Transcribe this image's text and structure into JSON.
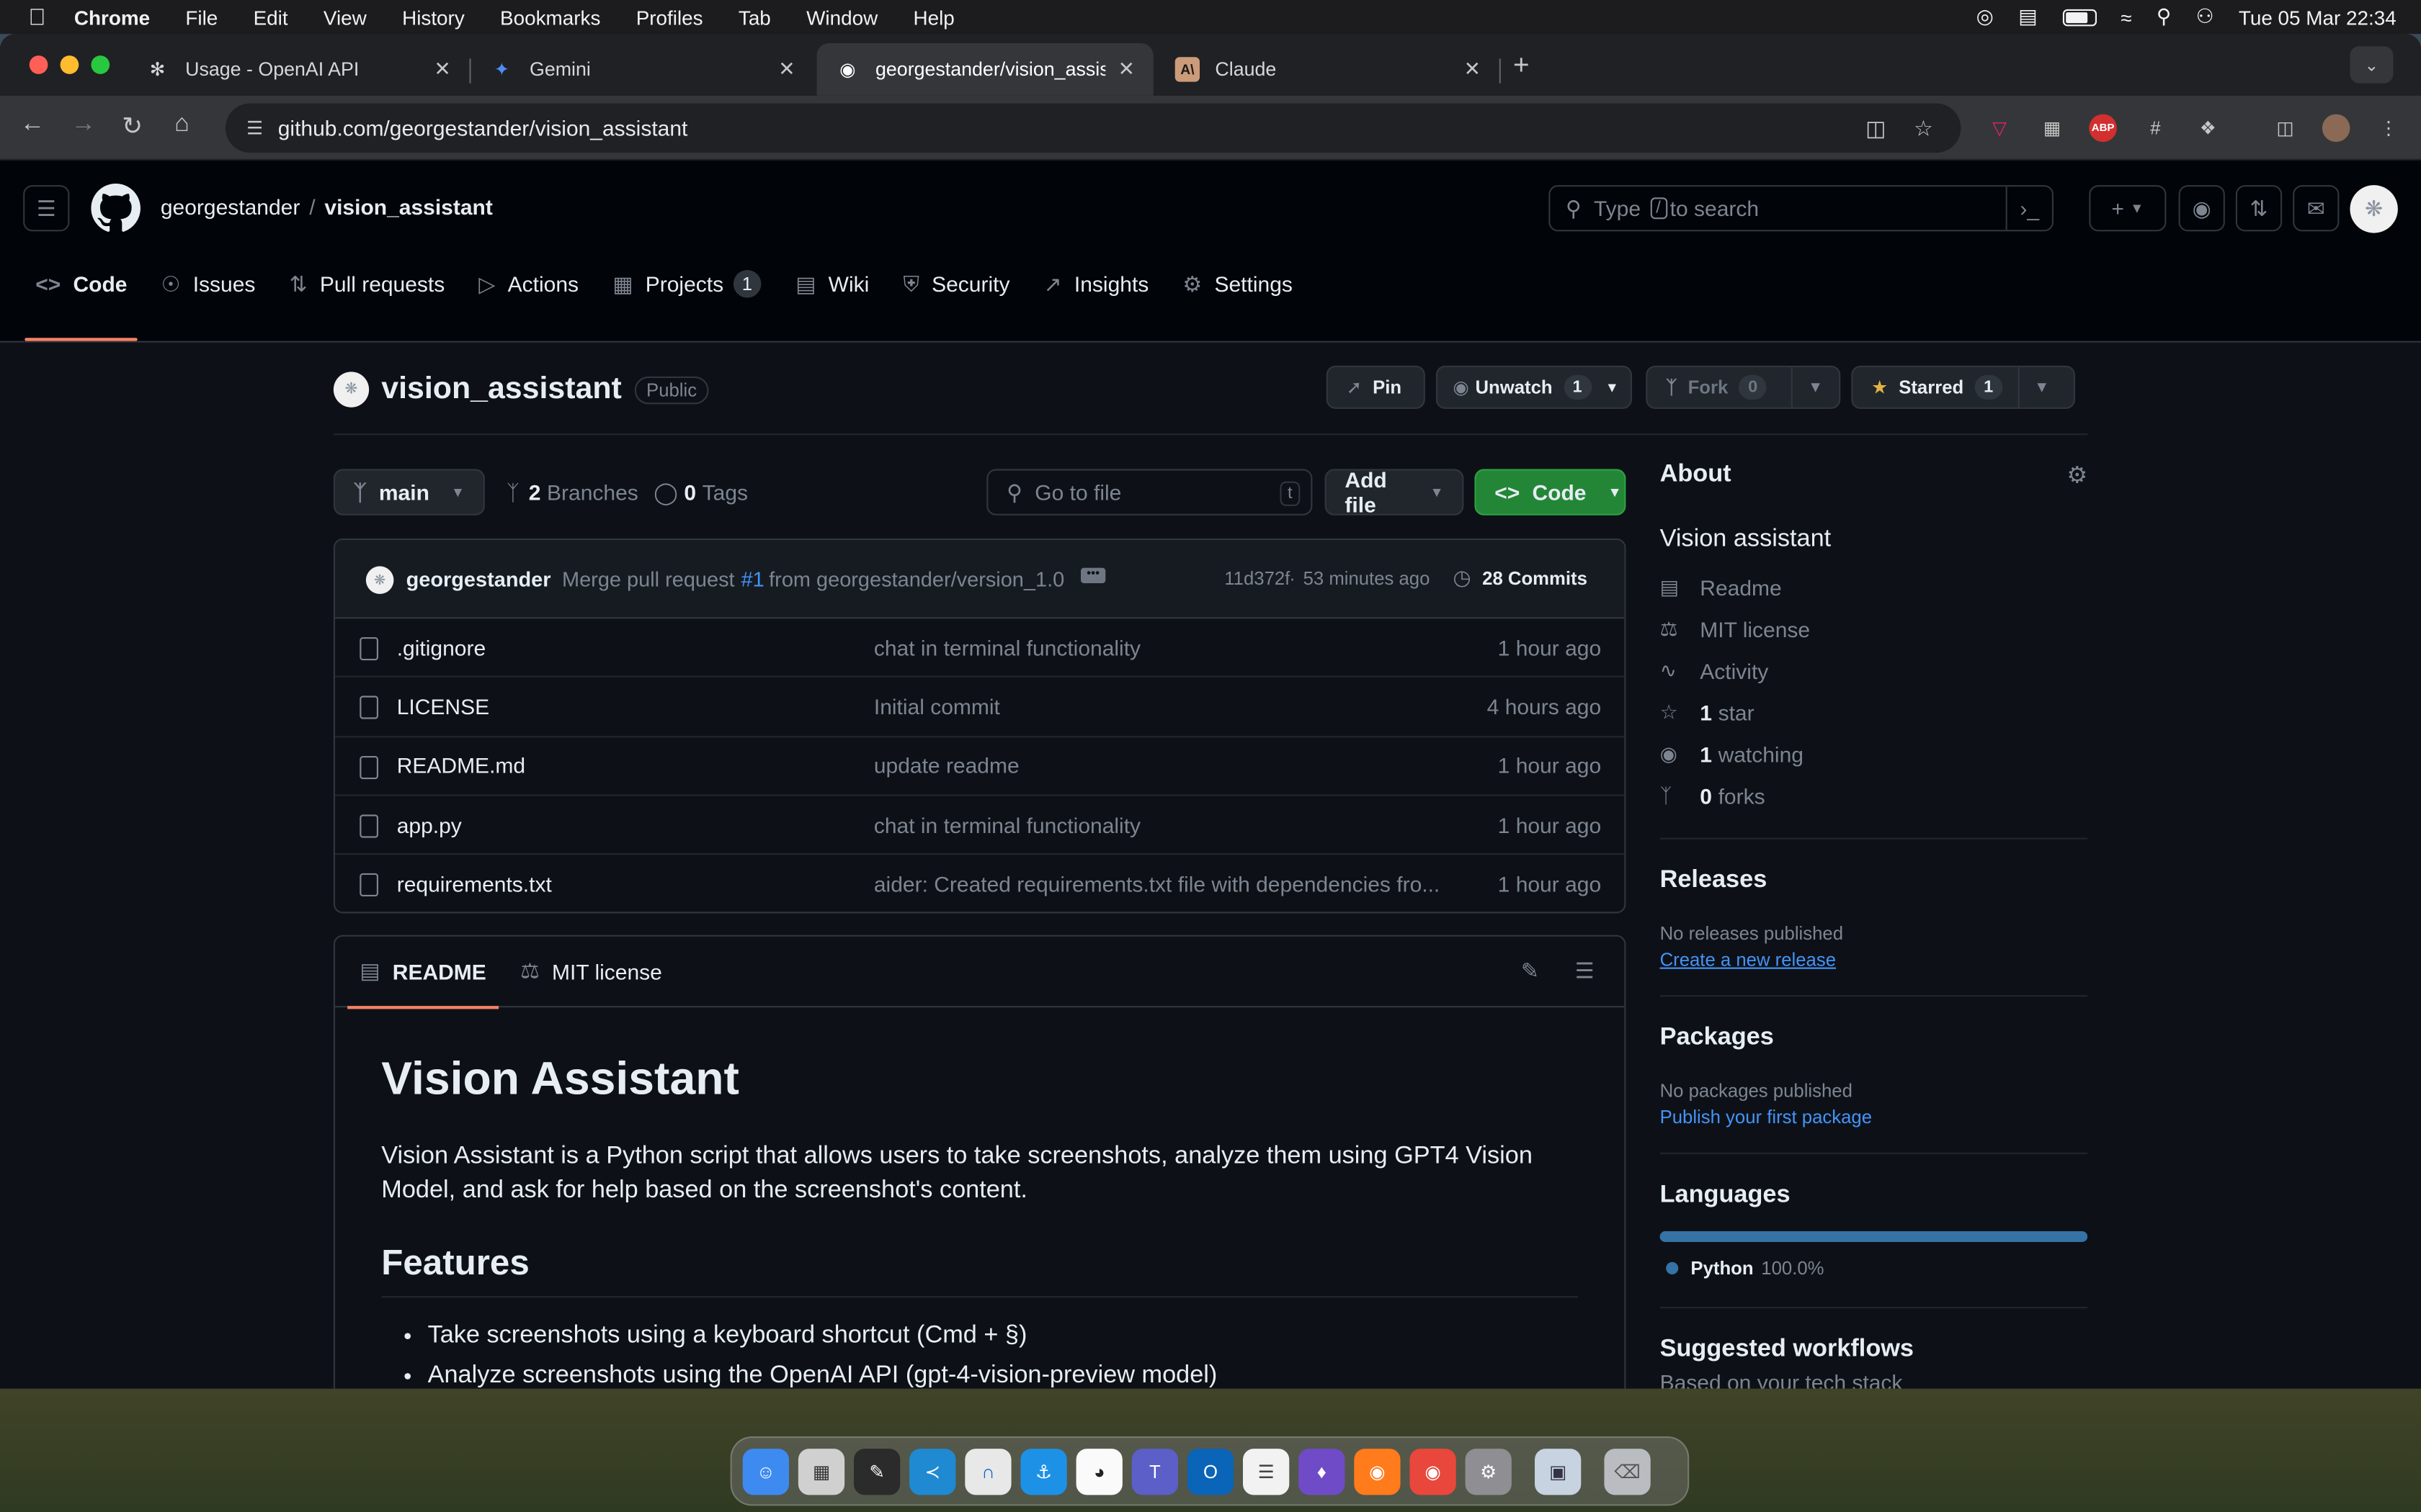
{
  "menubar": {
    "app": "Chrome",
    "items": [
      "File",
      "Edit",
      "View",
      "History",
      "Bookmarks",
      "Profiles",
      "Tab",
      "Window",
      "Help"
    ],
    "datetime": "Tue 05 Mar  22:34"
  },
  "tabs": [
    {
      "title": "Usage - OpenAI API",
      "icon": "openai-icon"
    },
    {
      "title": "Gemini",
      "icon": "gemini-icon"
    },
    {
      "title": "georgestander/vision_assista",
      "icon": "github-icon"
    },
    {
      "title": "Claude",
      "icon": "anthropic-icon"
    }
  ],
  "omnibox": {
    "url": "github.com/georgestander/vision_assistant"
  },
  "header": {
    "owner": "georgestander",
    "separator": "/",
    "repo": "vision_assistant",
    "search_placeholder_pre": "Type",
    "search_key": "/",
    "search_placeholder_post": "to search"
  },
  "repo_tabs": [
    {
      "label": "Code",
      "icon": "code-icon",
      "active": true
    },
    {
      "label": "Issues",
      "icon": "issue-icon"
    },
    {
      "label": "Pull requests",
      "icon": "pull-request-icon"
    },
    {
      "label": "Actions",
      "icon": "play-icon"
    },
    {
      "label": "Projects",
      "icon": "table-icon",
      "counter": "1"
    },
    {
      "label": "Wiki",
      "icon": "book-icon"
    },
    {
      "label": "Security",
      "icon": "shield-icon"
    },
    {
      "label": "Insights",
      "icon": "graph-icon"
    },
    {
      "label": "Settings",
      "icon": "gear-icon"
    }
  ],
  "repo": {
    "name": "vision_assistant",
    "visibility": "Public",
    "pin": "Pin",
    "unwatch": "Unwatch",
    "watch_count": "1",
    "fork": "Fork",
    "fork_count": "0",
    "starred": "Starred",
    "star_count": "1"
  },
  "branchbar": {
    "branch": "main",
    "branches_count": "2",
    "branches_label": "Branches",
    "tags_count": "0",
    "tags_label": "Tags",
    "goto_placeholder": "Go to file",
    "goto_key": "t",
    "add_file": "Add file",
    "code": "Code"
  },
  "commit": {
    "author": "georgestander",
    "message_pre": "Merge pull request",
    "pr": "#1",
    "message_post": "from georgestander/version_1.0",
    "sha": "11d372f",
    "age": "53 minutes ago",
    "commits": "28 Commits"
  },
  "files": [
    {
      "name": ".gitignore",
      "message": "chat in terminal functionality",
      "time": "1 hour ago"
    },
    {
      "name": "LICENSE",
      "message": "Initial commit",
      "time": "4 hours ago"
    },
    {
      "name": "README.md",
      "message": "update readme",
      "time": "1 hour ago"
    },
    {
      "name": "app.py",
      "message": "chat in terminal functionality",
      "time": "1 hour ago"
    },
    {
      "name": "requirements.txt",
      "message": "aider: Created requirements.txt file with dependencies fro...",
      "time": "1 hour ago"
    }
  ],
  "readme": {
    "tab_readme": "README",
    "tab_license": "MIT license",
    "h1": "Vision Assistant",
    "intro": "Vision Assistant is a Python script that allows users to take screenshots, analyze them using GPT4 Vision Model, and ask for help based on the screenshot's content.",
    "h2": "Features",
    "features": [
      "Take screenshots using a keyboard shortcut (Cmd + §)",
      "Analyze screenshots using the OpenAI API (gpt-4-vision-preview model)"
    ]
  },
  "about": {
    "title": "About",
    "description": "Vision assistant",
    "links": [
      {
        "icon": "book-icon",
        "label": "Readme"
      },
      {
        "icon": "law-icon",
        "label": "MIT license"
      },
      {
        "icon": "pulse-icon",
        "label": "Activity"
      },
      {
        "icon": "star-icon",
        "count": "1",
        "label": "star"
      },
      {
        "icon": "eye-icon",
        "count": "1",
        "label": "watching"
      },
      {
        "icon": "fork-icon",
        "count": "0",
        "label": "forks"
      }
    ]
  },
  "releases": {
    "title": "Releases",
    "none": "No releases published",
    "link": "Create a new release"
  },
  "packages": {
    "title": "Packages",
    "none": "No packages published",
    "link": "Publish your first package"
  },
  "languages": {
    "title": "Languages",
    "name": "Python",
    "percent": "100.0%",
    "color": "#3572a5",
    "fraction": 1.0
  },
  "workflows": {
    "title": "Suggested workflows",
    "subtitle": "Based on your tech stack"
  },
  "colors": {
    "accent_green": "#238636",
    "link_blue": "#4493f8",
    "tab_underline": "#f78166"
  }
}
